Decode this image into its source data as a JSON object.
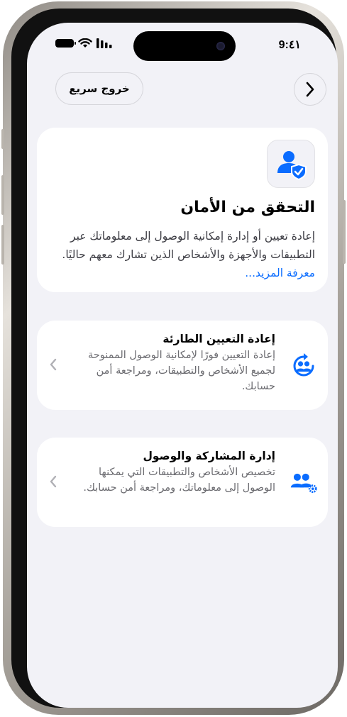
{
  "status_bar": {
    "time": "9:٤١"
  },
  "nav": {
    "quick_exit_label": "خروج سريع"
  },
  "hero": {
    "title": "التحقق من الأمان",
    "description": "إعادة تعيين أو إدارة إمكانية الوصول إلى معلوماتك عبر التطبيقات والأجهزة والأشخاص الذين تشارك معهم حاليًا.",
    "learn_more": "معرفة المزيد..."
  },
  "options": [
    {
      "title": "إعادة التعيين الطارئة",
      "description": "إعادة التعيين فورًا لإمكانية الوصول الممنوحة لجميع الأشخاص والتطبيقات، ومراجعة أمن حسابك."
    },
    {
      "title": "إدارة المشاركة والوصول",
      "description": "تخصيص الأشخاص والتطبيقات التي يمكنها الوصول إلى معلوماتك، ومراجعة أمن حسابك."
    }
  ],
  "colors": {
    "accent": "#0a6cff",
    "background": "#f2f2f7",
    "card": "#ffffff"
  },
  "icons": {
    "hero": "person-shield-icon",
    "option1": "emergency-reset-icon",
    "option2": "people-gear-icon"
  }
}
